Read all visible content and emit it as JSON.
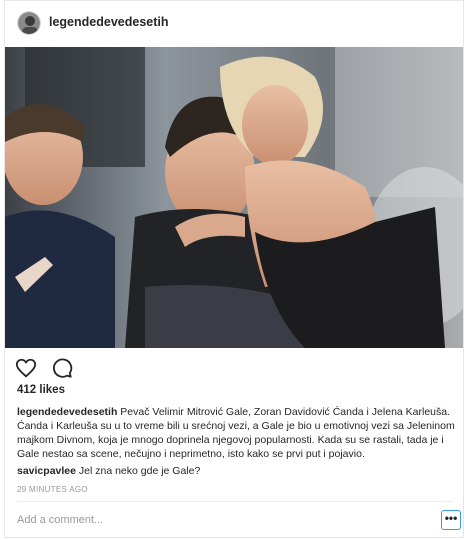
{
  "post": {
    "username": "legendedevedesetih",
    "likes": "412 likes",
    "caption": "Pevač Velimir Mitrović Gale, Zoran Davidović Ćanda i Jelena Karleuša. Ćanda i Karleuša su u to vreme bili u srećnoj vezi, a Gale je bio u emotivnoj vezi sa Jeleninom majkom Divnom, koja je mnogo doprinela njegovoj popularnosti. Kada su se rastali, tada je i Gale nestao sa scene, nečujno i neprimetno, isto kako se prvi put i pojavio.",
    "comments": [
      {
        "username": "savicpavlee",
        "text": "Jel zna neko gde je Gale?"
      }
    ],
    "timestamp": "29 MINUTES AGO"
  },
  "actions": {
    "like_icon": "heart-icon",
    "comment_icon": "comment-bubble-icon"
  },
  "add_comment": {
    "placeholder": "Add a comment..."
  },
  "more_button": {
    "label": "•••",
    "border_color": "#3897f0"
  }
}
